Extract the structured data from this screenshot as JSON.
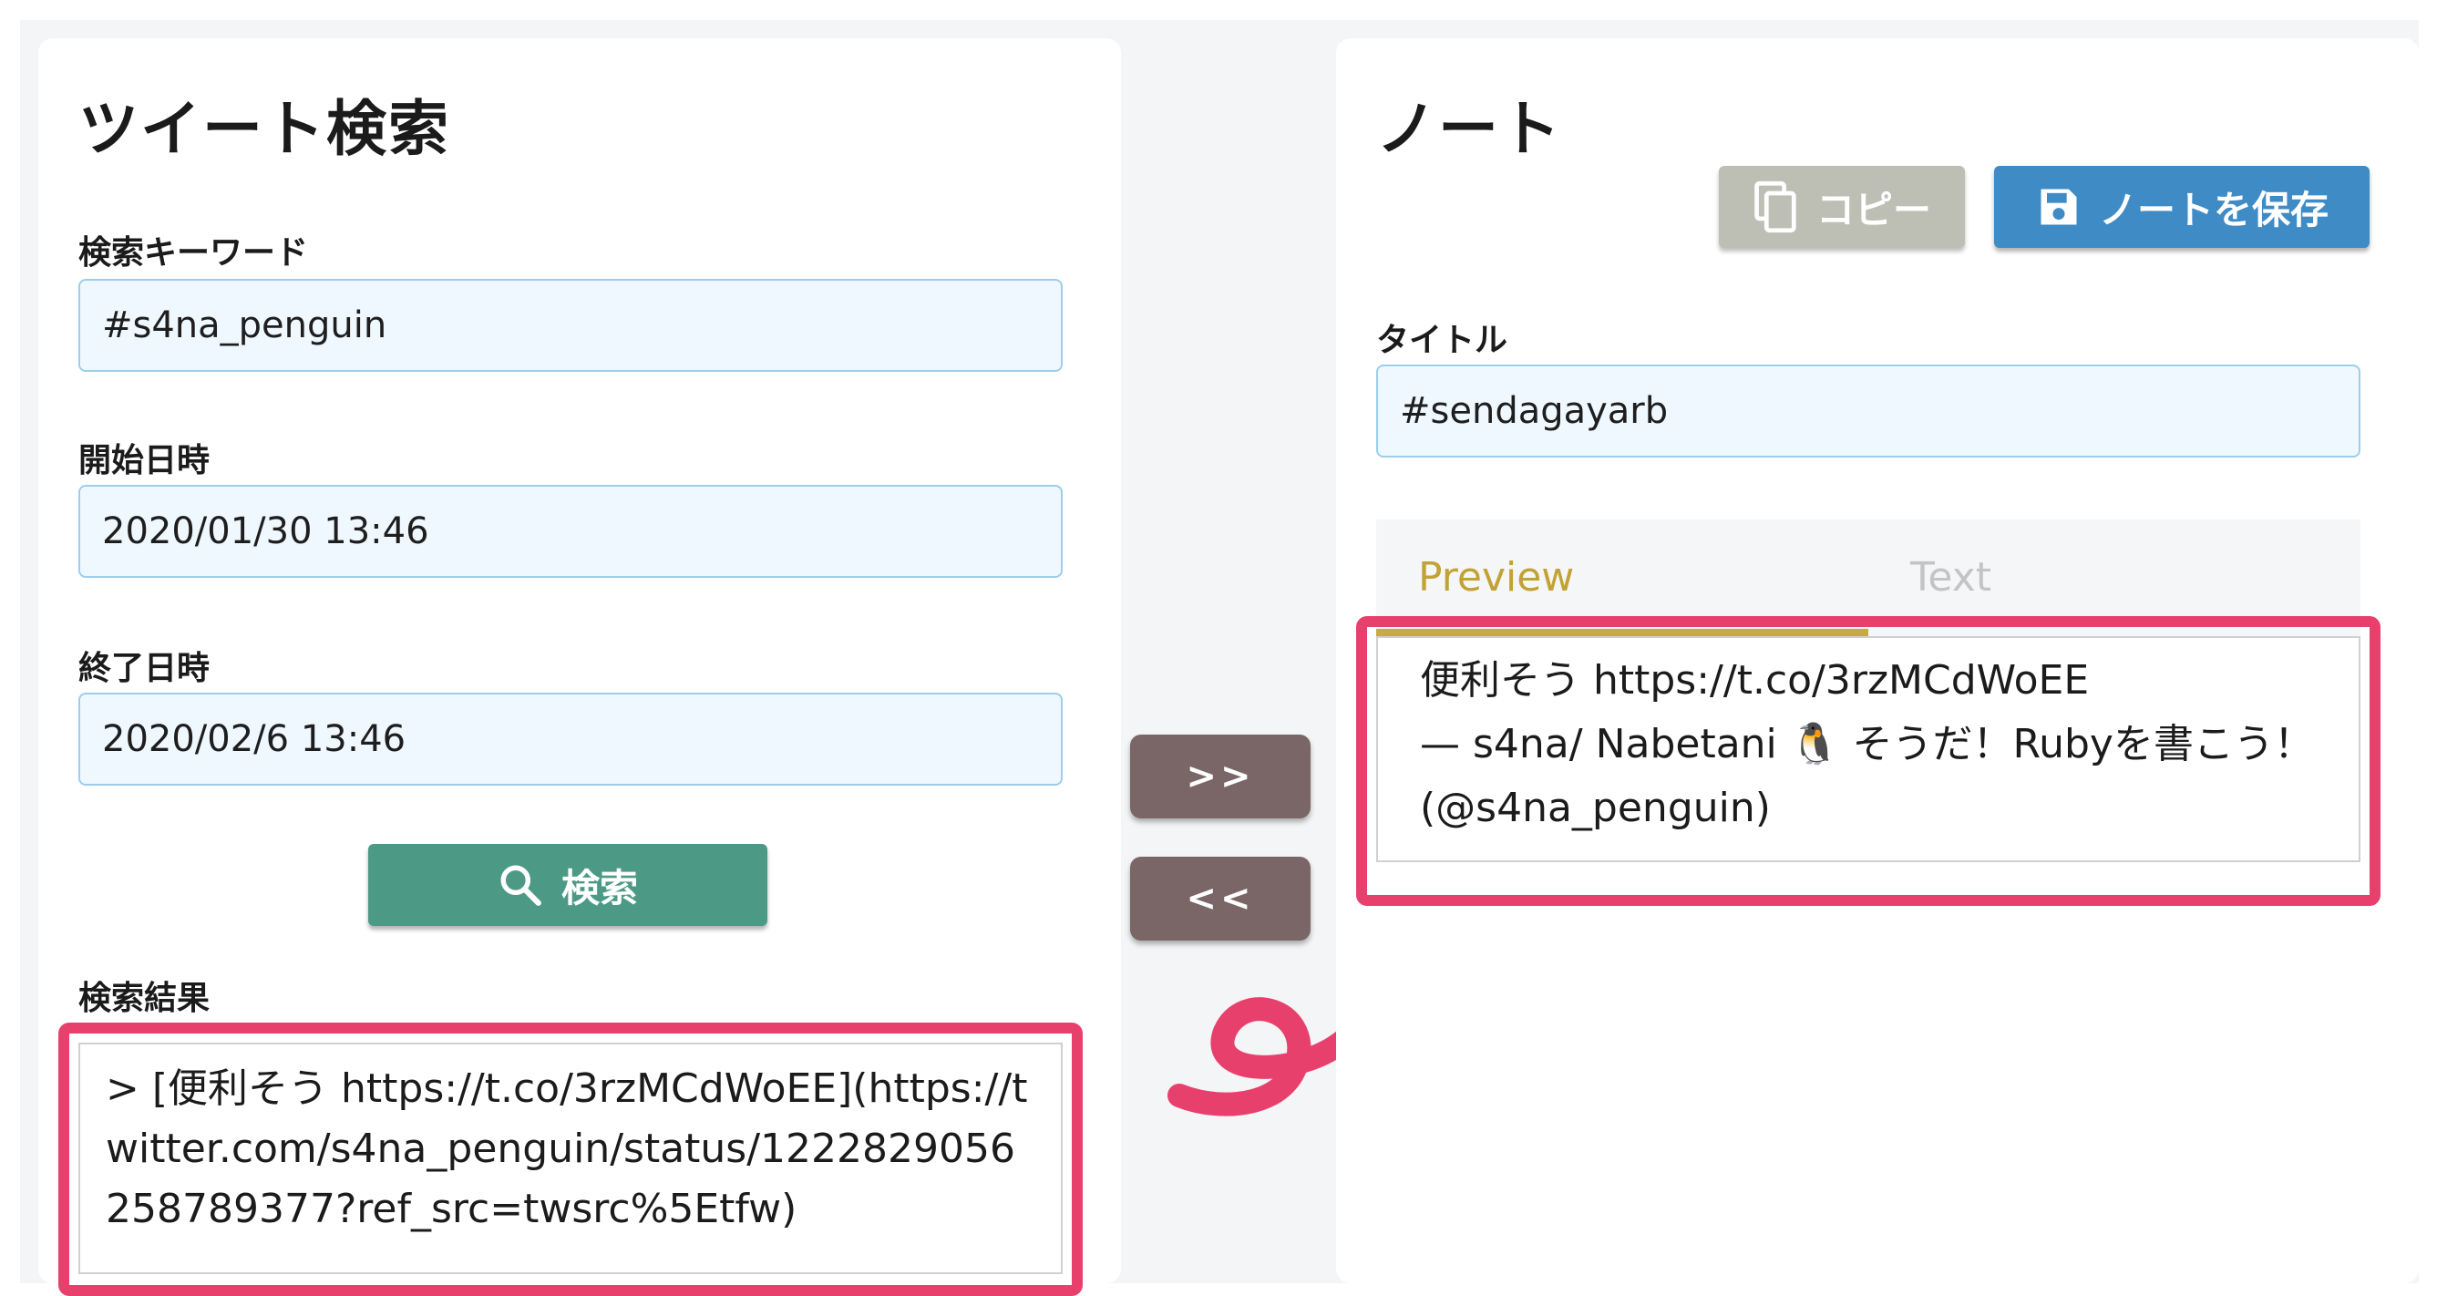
{
  "search_panel": {
    "title": "ツイート検索",
    "keyword_label": "検索キーワード",
    "keyword_value": "#s4na_penguin",
    "start_label": "開始日時",
    "start_value": "2020/01/30 13:46",
    "end_label": "終了日時",
    "end_value": "2020/02/6 13:46",
    "search_button_label": "検索",
    "results_label": "検索結果",
    "results_text": "> [便利そう https://t.co/3rzMCdWoEE](https://twitter.com/s4na_penguin/status/1222829056258789377?ref_src=twsrc%5Etfw)"
  },
  "transfer": {
    "to_note_label": ">>",
    "to_search_label": "<<"
  },
  "note_panel": {
    "title": "ノート",
    "copy_button_label": "コピー",
    "save_button_label": "ノートを保存",
    "title_label": "タイトル",
    "title_value": "#sendagayarb",
    "tabs": [
      {
        "label": "Preview",
        "active": true
      },
      {
        "label": "Text",
        "active": false
      }
    ],
    "preview_lines": [
      "便利そう https://t.co/3rzMCdWoEE",
      "— s4na/ Nabetani 🐧 そうだ！Rubyを書こう！",
      "(@s4na_penguin)"
    ]
  },
  "colors": {
    "search_button": "#4c9a86",
    "save_button": "#3e8bc5",
    "copy_button": "#bdbfb5",
    "transfer_button": "#7a6666",
    "highlight": "#e8406d",
    "active_tab": "#c3a235"
  }
}
